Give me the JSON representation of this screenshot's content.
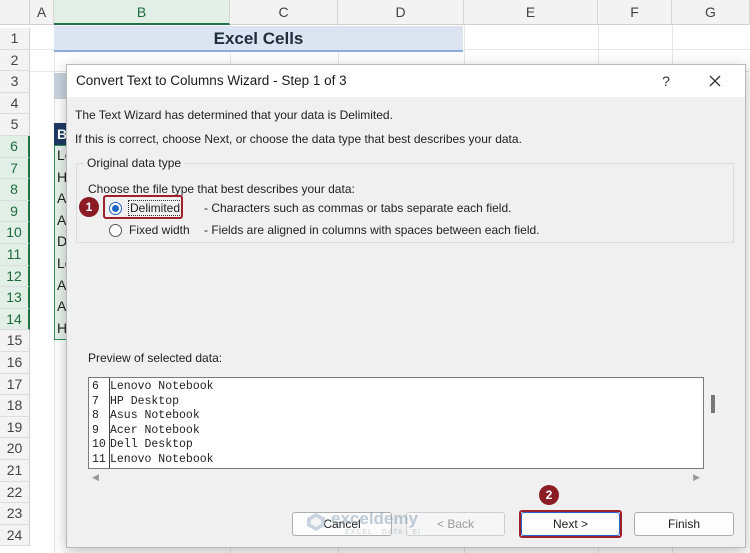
{
  "spreadsheet": {
    "columns": [
      "A",
      "B",
      "C",
      "D",
      "E",
      "F",
      "G"
    ],
    "selected_column": "B",
    "rows": [
      "1",
      "2",
      "3",
      "4",
      "5",
      "6",
      "7",
      "8",
      "9",
      "10",
      "11",
      "12",
      "13",
      "14",
      "15",
      "16",
      "17",
      "18",
      "19",
      "20",
      "21",
      "22",
      "23",
      "24"
    ],
    "selected_rows": [
      "6",
      "7",
      "8",
      "9",
      "10",
      "11",
      "12",
      "13",
      "14"
    ],
    "title_cell": "Excel Cells",
    "header_cell": "B",
    "data_cells": [
      "Le",
      "H",
      "A",
      "A",
      "D",
      "Le",
      "A",
      "A",
      "H"
    ]
  },
  "dialog": {
    "title": "Convert Text to Columns Wizard - Step 1 of 3",
    "help": "?",
    "message1": "The Text Wizard has determined that your data is Delimited.",
    "message2": "If this is correct, choose Next, or choose the data type that best describes your data.",
    "group_label": "Original data type",
    "choose_label": "Choose the file type that best describes your data:",
    "options": [
      {
        "label": "Delimited",
        "checked": true,
        "description": "- Characters such as commas or tabs separate each field."
      },
      {
        "label": "Fixed width",
        "checked": false,
        "description": "- Fields are aligned in columns with spaces between each field."
      }
    ],
    "preview_label": "Preview of selected data:",
    "preview_lines": [
      {
        "num": "6",
        "text": "Lenovo Notebook"
      },
      {
        "num": "7",
        "text": "HP Desktop"
      },
      {
        "num": "8",
        "text": "Asus Notebook"
      },
      {
        "num": "9",
        "text": "Acer Notebook"
      },
      {
        "num": "10",
        "text": "Dell Desktop"
      },
      {
        "num": "11",
        "text": "Lenovo Notebook"
      }
    ],
    "buttons": {
      "cancel": "Cancel",
      "back": "< Back",
      "next": "Next >",
      "finish": "Finish"
    }
  },
  "annotations": {
    "marker1": "1",
    "marker2": "2",
    "color": "#8b1c24"
  },
  "watermark": {
    "name": "exceldemy",
    "tagline": "EXCEL · DATA · BI"
  }
}
